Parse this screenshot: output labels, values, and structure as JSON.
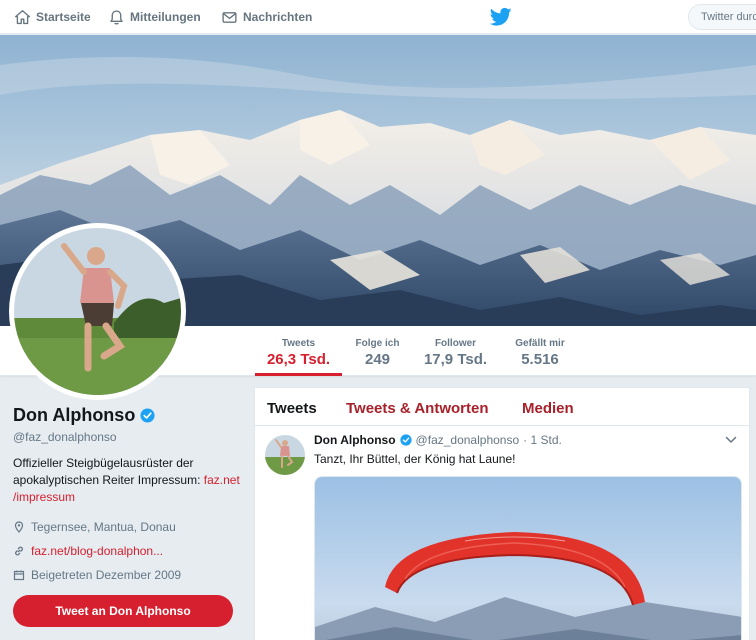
{
  "nav": {
    "home_label": "Startseite",
    "notifications_label": "Mitteilungen",
    "messages_label": "Nachrichten",
    "search_placeholder": "Twitter durchsuchen"
  },
  "stats": [
    {
      "label": "Tweets",
      "value": "26,3 Tsd."
    },
    {
      "label": "Folge ich",
      "value": "249"
    },
    {
      "label": "Follower",
      "value": "17,9 Tsd."
    },
    {
      "label": "Gefällt mir",
      "value": "5.516"
    }
  ],
  "profile": {
    "name": "Don Alphonso",
    "handle": "@faz_donalphonso",
    "bio_text": "Offizieller Steigbügelausrüster der apokalyptischen Reiter Impressum: ",
    "bio_link_1": "faz.net",
    "bio_link_2": "/impressum",
    "location": "Tegernsee, Mantua, Donau",
    "website": "faz.net/blog-donalphon...",
    "joined": "Beigetreten Dezember 2009",
    "tweet_button_label": "Tweet an Don Alphonso"
  },
  "timeline": {
    "tabs": [
      "Tweets",
      "Tweets & Antworten",
      "Medien"
    ],
    "tweet": {
      "name": "Don Alphonso",
      "handle": "@faz_donalphonso",
      "time": "· 1 Std.",
      "text": "Tanzt, Ihr Büttel, der König hat Laune!"
    }
  },
  "colors": {
    "accent": "#d6202f",
    "twitter_blue": "#1da1f2",
    "verified": "#1da1f2"
  },
  "icons": {
    "home": "home-icon",
    "notifications": "bell-icon",
    "messages": "envelope-icon",
    "logo": "twitter-bird-icon",
    "location": "location-pin-icon",
    "website": "link-icon",
    "joined": "calendar-icon",
    "verified": "verified-badge-icon",
    "caret": "chevron-down-icon"
  }
}
